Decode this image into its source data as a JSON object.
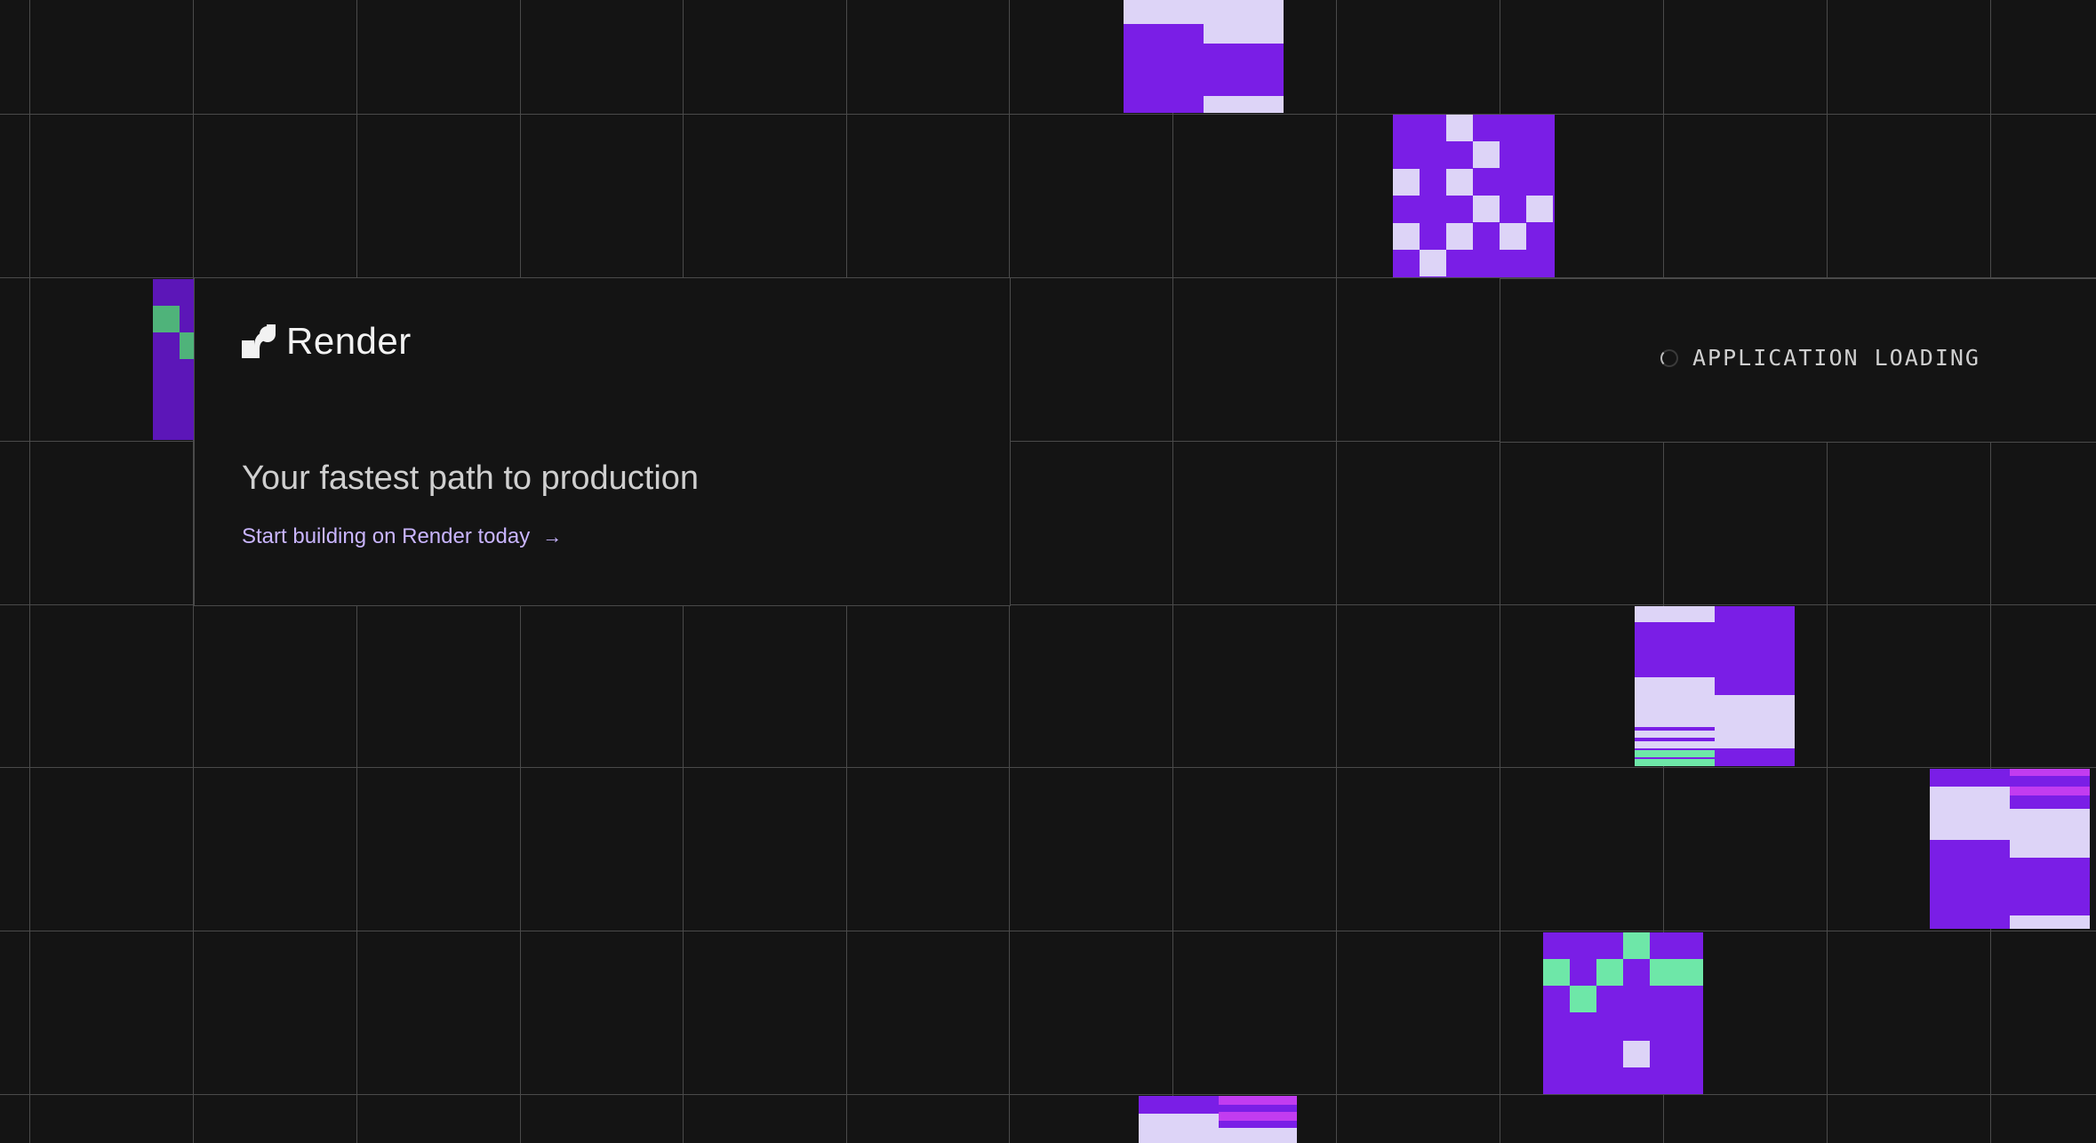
{
  "brand": {
    "name": "Render",
    "logo_icon": "render-logo-icon"
  },
  "hero": {
    "headline": "Your fastest path to production",
    "cta_label": "Start building on Render today",
    "cta_icon": "arrow-right-icon",
    "cta_arrow": "→"
  },
  "status": {
    "text": "APPLICATION LOADING",
    "icon": "loading-spinner-icon"
  },
  "colors": {
    "background": "#141414",
    "grid_line": "#4a4a4a",
    "tile_purple": "#7a1ee6",
    "tile_lavender": "#ddd4f7",
    "tile_green": "#6ee7a8",
    "tile_magenta": "#c23cf0",
    "cta_text": "#c9b5ff"
  }
}
